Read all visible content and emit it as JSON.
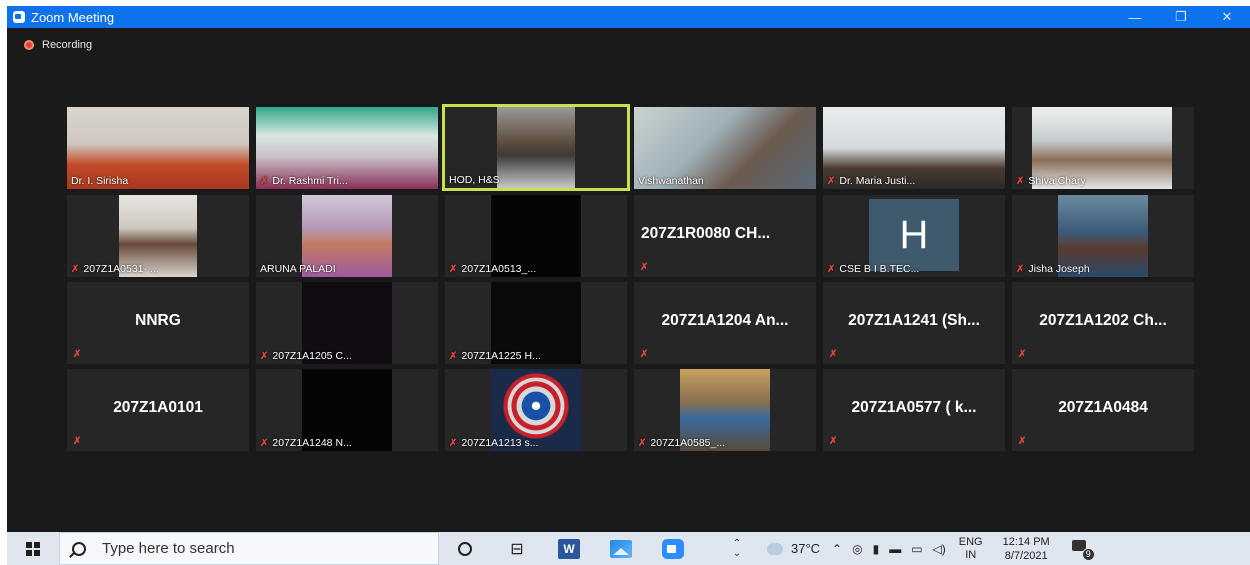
{
  "window": {
    "title": "Zoom Meeting",
    "minimize": "—",
    "maximize": "❐",
    "close": "✕"
  },
  "recording": {
    "label": "Recording"
  },
  "participants": [
    {
      "name": "Dr. I. Sirisha"
    },
    {
      "name": "Dr. Rashmi Tri..."
    },
    {
      "name": "HOD, H&S"
    },
    {
      "name": "Vishwanathan"
    },
    {
      "name": "Dr. Maria Justi..."
    },
    {
      "name": "Shiva Chary"
    },
    {
      "name": "207Z1A0531- ..."
    },
    {
      "name": "ARUNA PALADI"
    },
    {
      "name": "207Z1A0513_..."
    },
    {
      "name": "207Z1R0080 CH..."
    },
    {
      "name": "CSE B I B.TEC...",
      "initial": "H"
    },
    {
      "name": "Jisha Joseph"
    },
    {
      "name": "NNRG"
    },
    {
      "name": "207Z1A1205 C..."
    },
    {
      "name": "207Z1A1225 H..."
    },
    {
      "name": "207Z1A1204 An..."
    },
    {
      "name": "207Z1A1241 (Sh..."
    },
    {
      "name": "207Z1A1202 Ch..."
    },
    {
      "name": "207Z1A0101"
    },
    {
      "name": "207Z1A1248 N..."
    },
    {
      "name": "207Z1A1213 s..."
    },
    {
      "name": "207Z1A0585_..."
    },
    {
      "name": "207Z1A0577 ( k..."
    },
    {
      "name": "207Z1A0484"
    }
  ],
  "taskbar": {
    "search_placeholder": "Type here to search",
    "temperature": "37°C",
    "lang_top": "ENG",
    "lang_bottom": "IN",
    "time": "12:14 PM",
    "date": "8/7/2021",
    "notification_count": "9"
  },
  "colors": {
    "titlebar": "#0e72ed",
    "active_speaker_border": "#c8e04d",
    "muted_mic": "#e0443a"
  }
}
